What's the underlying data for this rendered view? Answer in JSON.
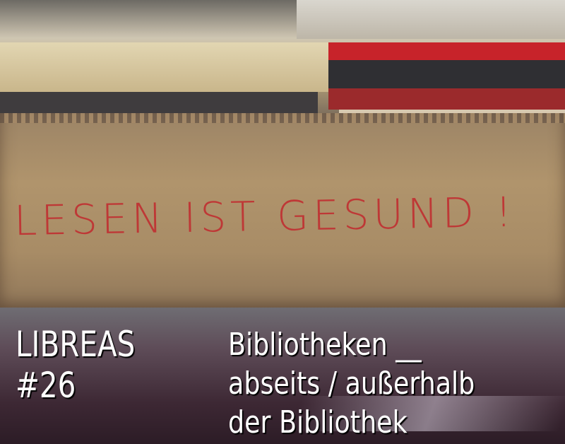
{
  "photo": {
    "box_handwriting": "LESEN IST GESUND !",
    "colors": {
      "cardboard": "#a88c66",
      "handwriting": "#c2292e",
      "ground": "#3d2834"
    }
  },
  "cover": {
    "magazine": "LIBREAS",
    "issue": "#26",
    "title_lines": [
      "Bibliotheken __",
      "abseits / außerhalb",
      "der Bibliothek"
    ]
  }
}
